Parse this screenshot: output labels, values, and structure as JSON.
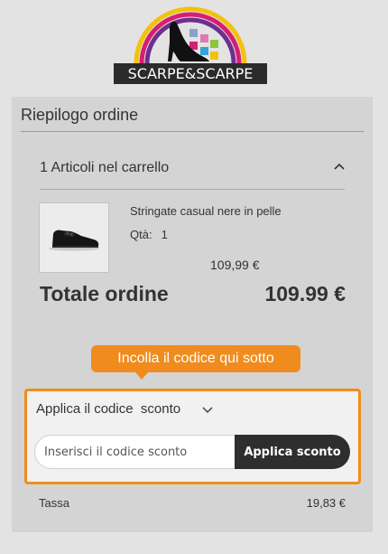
{
  "brand": {
    "logo_text": "SCARPE&SCARPE"
  },
  "summary": {
    "title": "Riepilogo ordine",
    "cart_header": "1 Articoli nel carrello",
    "item": {
      "name": "Stringate casual nere in pelle",
      "qty_label": "Qtà:",
      "qty_value": "1",
      "price": "109,99 €",
      "image": "black-leather-shoe"
    },
    "total_label": "Totale ordine",
    "total_value": "109.99 €"
  },
  "discount": {
    "tooltip": "Incolla il codice qui sotto",
    "toggle_label": "Applica il codice  sconto",
    "input_placeholder": "Inserisci il codice sconto",
    "apply_label": "Applica sconto"
  },
  "tax": {
    "label": "Tassa",
    "value": "19,83 €"
  },
  "colors": {
    "accent_orange": "#f08c1e",
    "button_dark": "#2e2e2e",
    "panel_gray": "#d4d4d4",
    "page_gray": "#e3e3e3"
  },
  "icons": [
    "chevron-up-icon",
    "chevron-down-icon"
  ]
}
